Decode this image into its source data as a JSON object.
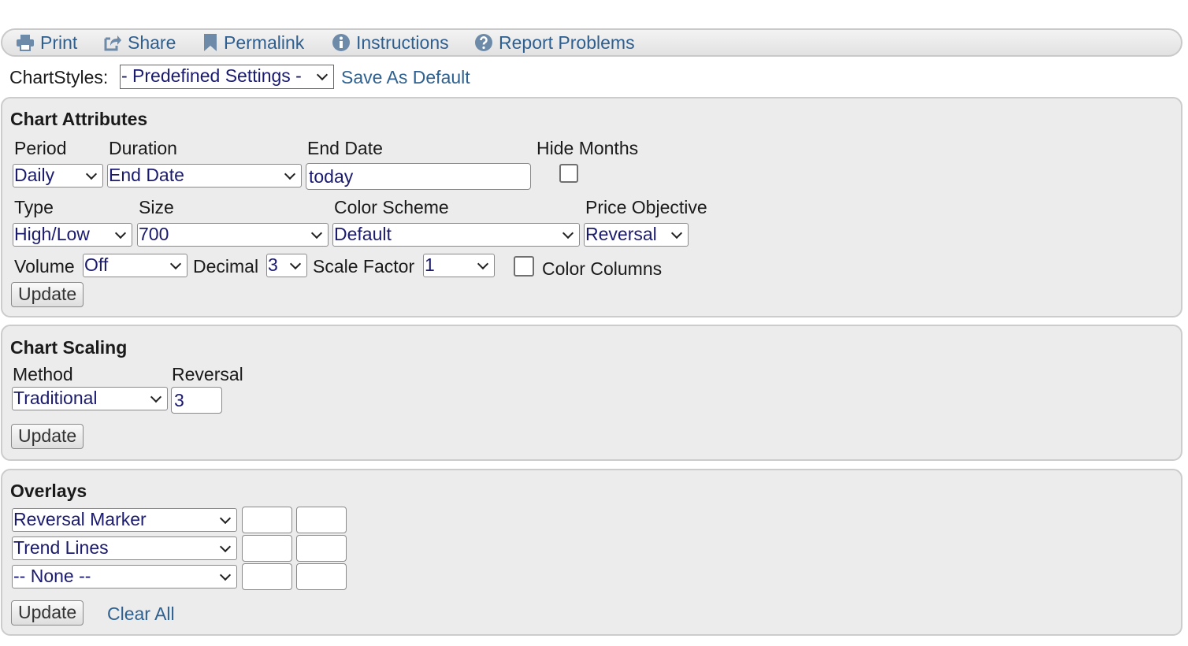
{
  "toolbar": {
    "print": "Print",
    "share": "Share",
    "permalink": "Permalink",
    "instructions": "Instructions",
    "report": "Report Problems"
  },
  "chartstyles": {
    "label": "ChartStyles:",
    "selected": "- Predefined Settings -",
    "save_default": "Save As Default"
  },
  "attributes": {
    "title": "Chart Attributes",
    "period": {
      "label": "Period",
      "value": "Daily"
    },
    "duration": {
      "label": "Duration",
      "value": "End Date"
    },
    "end_date": {
      "label": "End Date",
      "value": "today"
    },
    "hide_months": {
      "label": "Hide Months",
      "checked": false
    },
    "type": {
      "label": "Type",
      "value": "High/Low"
    },
    "size": {
      "label": "Size",
      "value": "700"
    },
    "color_scheme": {
      "label": "Color Scheme",
      "value": "Default"
    },
    "price_objective": {
      "label": "Price Objective",
      "value": "Reversal"
    },
    "volume": {
      "label": "Volume",
      "value": "Off"
    },
    "decimal": {
      "label": "Decimal",
      "value": "3"
    },
    "scale_factor": {
      "label": "Scale Factor",
      "value": "1"
    },
    "color_columns": {
      "label": "Color Columns",
      "checked": false
    },
    "update": "Update"
  },
  "scaling": {
    "title": "Chart Scaling",
    "method": {
      "label": "Method",
      "value": "Traditional"
    },
    "reversal": {
      "label": "Reversal",
      "value": "3"
    },
    "update": "Update"
  },
  "overlays": {
    "title": "Overlays",
    "rows": [
      {
        "select": "Reversal Marker",
        "param1": "",
        "param2": ""
      },
      {
        "select": "Trend Lines",
        "param1": "",
        "param2": ""
      },
      {
        "select": "-- None --",
        "param1": "",
        "param2": ""
      }
    ],
    "update": "Update",
    "clear_all": "Clear All"
  }
}
